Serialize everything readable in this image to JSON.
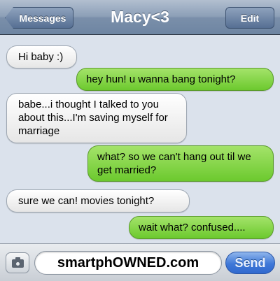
{
  "header": {
    "back_label": "Messages",
    "title": "Macy<3",
    "edit_label": "Edit"
  },
  "messages": [
    {
      "direction": "incoming",
      "text": "Hi baby :)"
    },
    {
      "direction": "outgoing",
      "text": "hey hun! u wanna bang tonight?"
    },
    {
      "direction": "incoming",
      "text": "babe...i thought I talked to you about this...I'm saving myself for marriage"
    },
    {
      "direction": "outgoing",
      "text": "what? so we can't hang out til we get married?"
    },
    {
      "direction": "incoming",
      "text": "sure we can! movies tonight?"
    },
    {
      "direction": "outgoing",
      "text": "wait what? confused...."
    }
  ],
  "composer": {
    "camera_icon": "camera-icon",
    "field_text": "smartphOWNED.com",
    "send_label": "Send"
  },
  "colors": {
    "incoming_bubble": "#ffffff",
    "outgoing_bubble": "#8bd54a",
    "navbar": "#8c9fb7",
    "send_button": "#3f78d8",
    "background": "#dbe2ec"
  }
}
